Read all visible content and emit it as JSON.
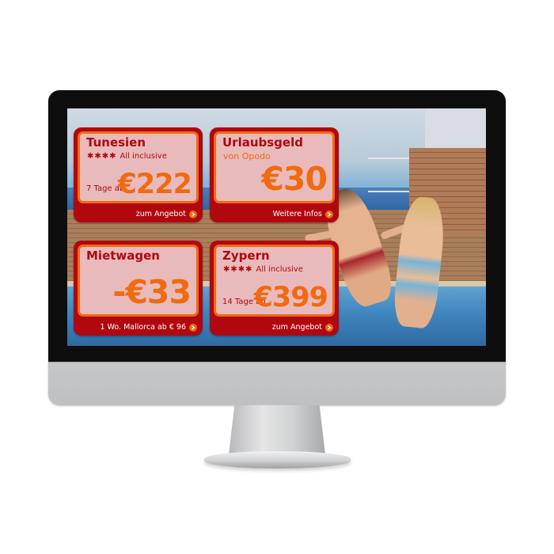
{
  "offers": [
    {
      "title": "Tunesien",
      "stars": "✱✱✱✱",
      "subtitle": "All inclusive",
      "duration": "7 Tage ab",
      "price": "€222",
      "link": "zum Angebot"
    },
    {
      "title": "Urlaubsgeld",
      "subtitle": "von Opodo",
      "price": "€30",
      "link": "Weitere Infos"
    },
    {
      "title": "Mietwagen",
      "price": "-€33",
      "link": "1 Wo. Mallorca ab € 96"
    },
    {
      "title": "Zypern",
      "stars": "✱✱✱✱",
      "subtitle": "All inclusive",
      "duration": "14 Tage ab",
      "price": "€399",
      "link": "zum Angebot"
    }
  ],
  "colors": {
    "card_red": "#b0080e",
    "accent_orange": "#f06a10"
  },
  "icons": {
    "link_arrow": "chevron-right-icon"
  }
}
